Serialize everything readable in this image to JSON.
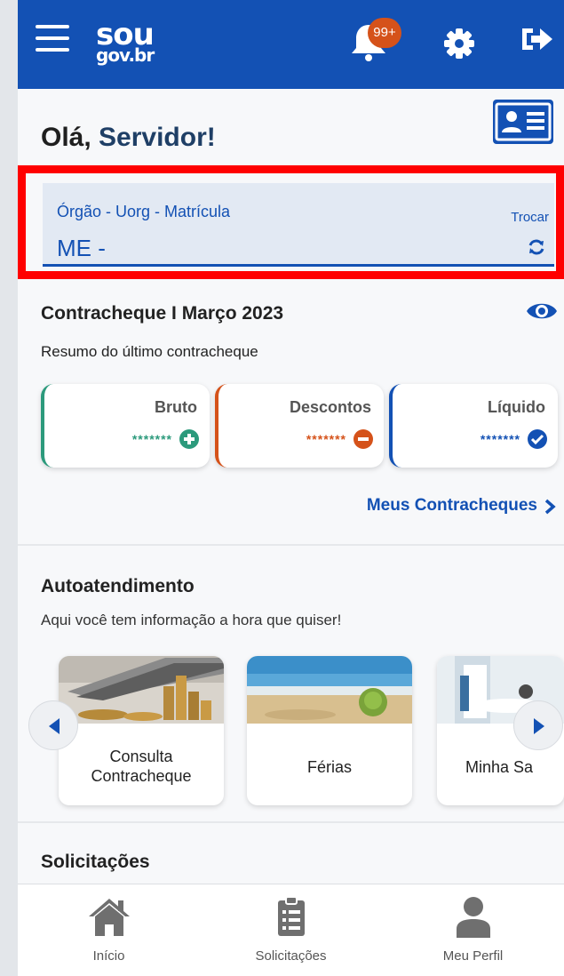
{
  "header": {
    "logo_top": "sou",
    "logo_bottom": "gov.br",
    "notifications_badge": "99+",
    "icons": [
      "menu-icon",
      "bell-icon",
      "gear-icon",
      "logout-icon"
    ]
  },
  "greeting": {
    "prefix": "Olá, ",
    "name": "Servidor!"
  },
  "org_field": {
    "label": "Órgão - Uorg - Matrícula",
    "value": "ME -",
    "action_label": "Trocar"
  },
  "contracheque": {
    "title": "Contracheque I Março 2023",
    "subtitle": "Resumo do último contracheque",
    "cards": [
      {
        "label": "Bruto",
        "value": "*******",
        "color": "#2c9a7c"
      },
      {
        "label": "Descontos",
        "value": "*******",
        "color": "#d5521a"
      },
      {
        "label": "Líquido",
        "value": "*******",
        "color": "#1351b4"
      }
    ],
    "link_label": "Meus Contracheques"
  },
  "autoatendimento": {
    "title": "Autoatendimento",
    "subtitle": "Aqui você tem informação a hora que quiser!",
    "tiles": [
      {
        "label": "Consulta Contracheque"
      },
      {
        "label": "Férias"
      },
      {
        "label": "Minha Sa"
      }
    ]
  },
  "solicitacoes": {
    "title": "Solicitações"
  },
  "bottom_nav": {
    "items": [
      {
        "label": "Início",
        "icon": "home-icon"
      },
      {
        "label": "Solicitações",
        "icon": "clipboard-icon"
      },
      {
        "label": "Meu Perfil",
        "icon": "user-icon"
      }
    ]
  },
  "colors": {
    "primary": "#1351b4",
    "highlight_border": "#ff0000",
    "badge": "#d5521a"
  }
}
